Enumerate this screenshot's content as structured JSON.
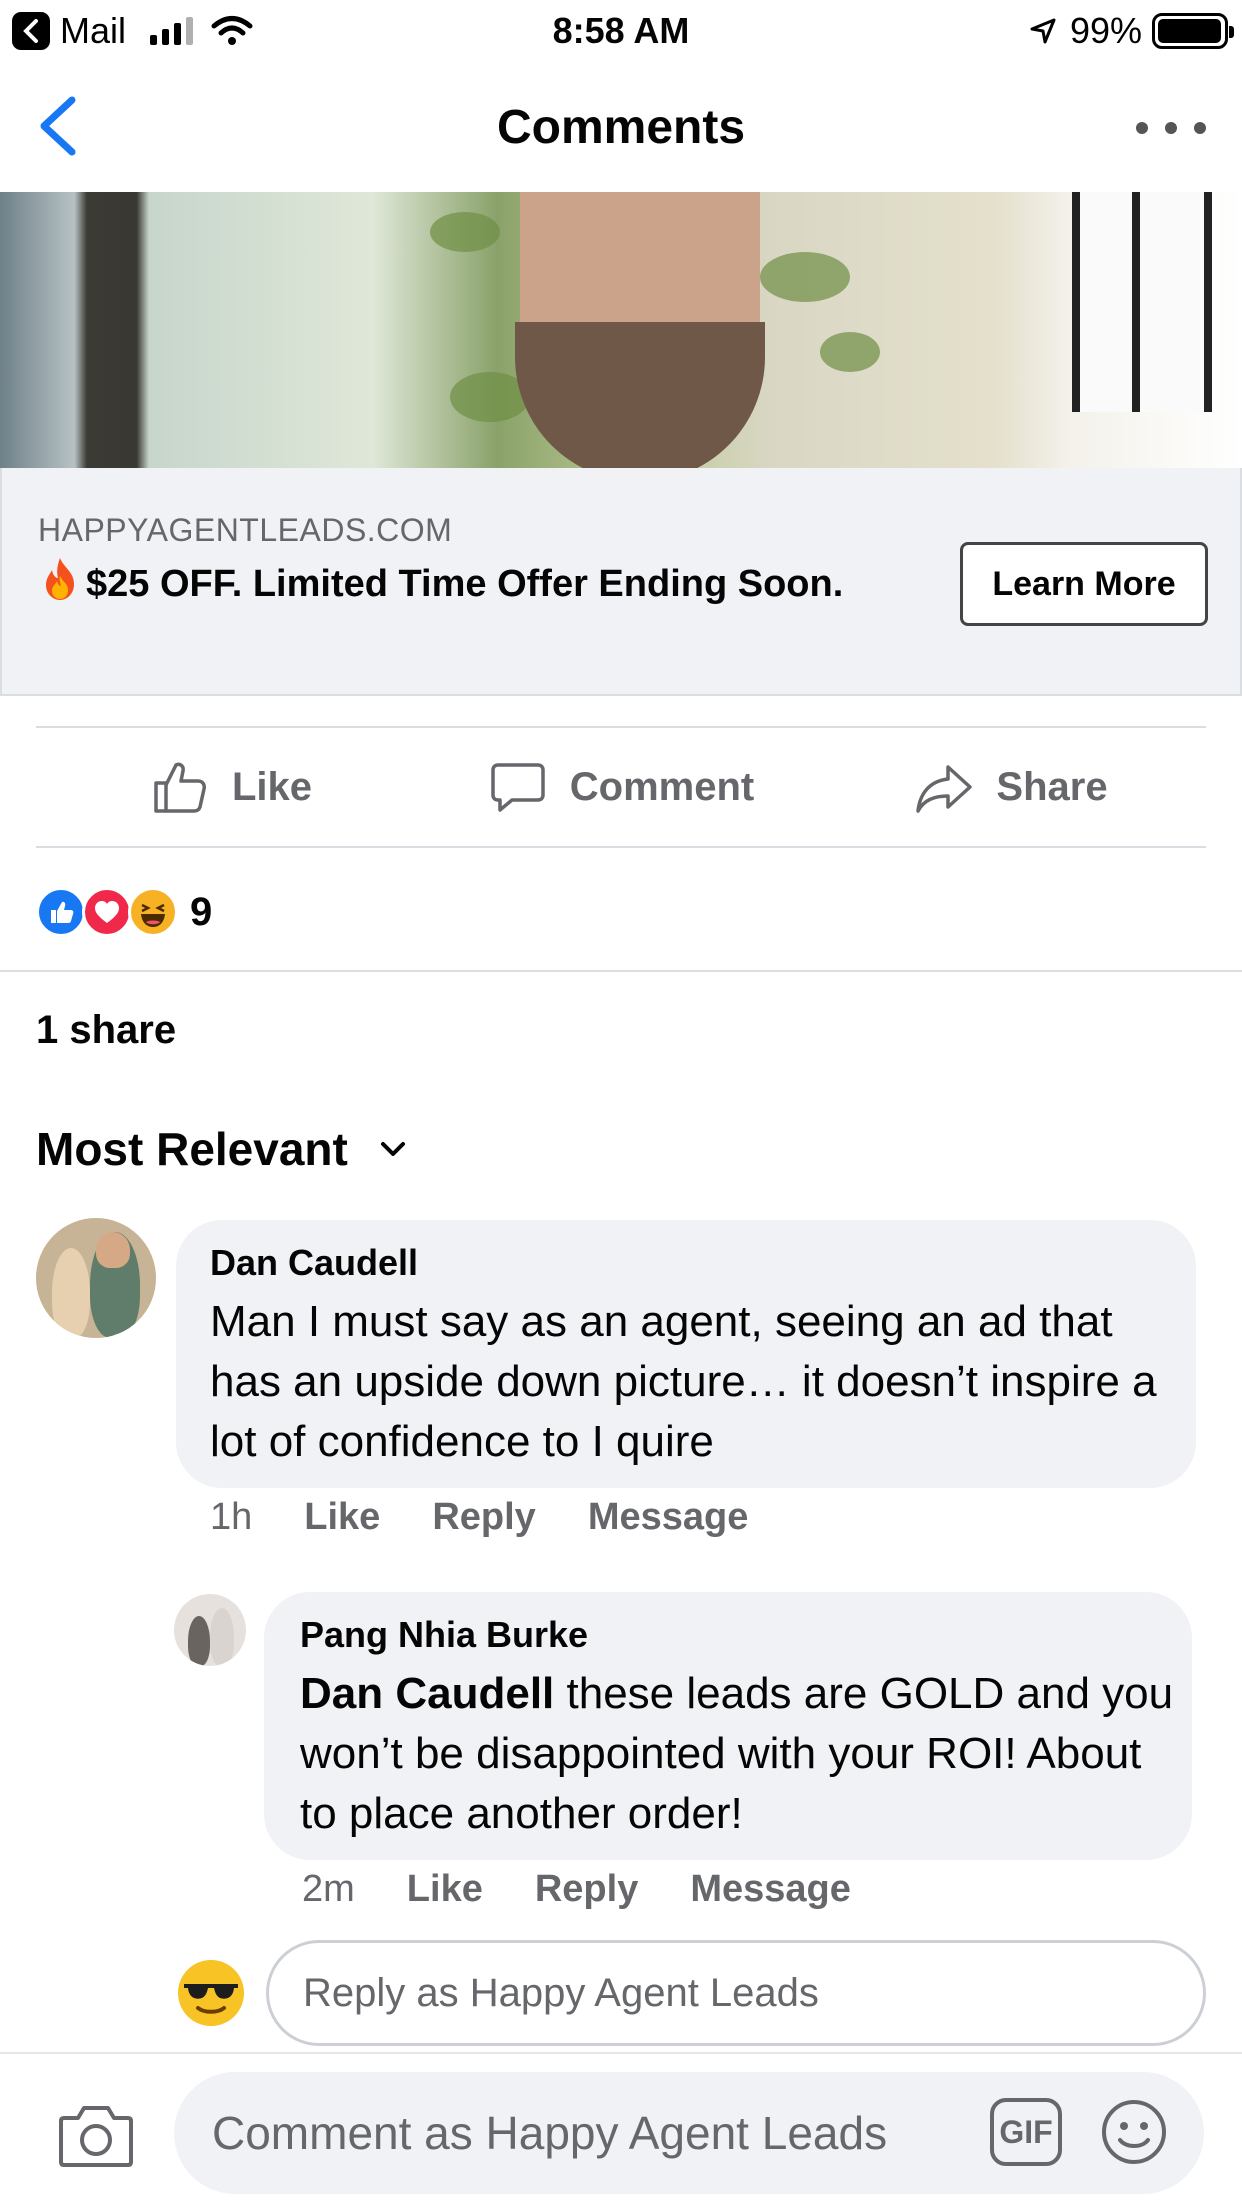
{
  "status_bar": {
    "back_app": "Mail",
    "time": "8:58 AM",
    "battery": "99%",
    "battery_level": 0.99
  },
  "nav": {
    "title": "Comments",
    "back_icon": "chevron-left-icon",
    "more_icon": "more-icon"
  },
  "ad": {
    "domain": "HAPPYAGENTLEADS.COM",
    "headline": "$25 OFF. Limited Time Offer Ending Soon.",
    "cta": "Learn More"
  },
  "actions": {
    "like": "Like",
    "comment": "Comment",
    "share": "Share"
  },
  "reactions": {
    "count": "9"
  },
  "shares": "1 share",
  "sort_label": "Most Relevant",
  "comments": [
    {
      "author": "Dan Caudell",
      "text": "Man I must say as an agent, seeing an ad that has an upside down picture… it doesn’t inspire a lot of confidence to I quire",
      "time": "1h",
      "like": "Like",
      "reply": "Reply",
      "message": "Message"
    },
    {
      "author": "Pang Nhia Burke",
      "mention": "Dan Caudell",
      "text": " these leads are GOLD and you won’t be disappointed with your ROI! About to place another order!",
      "time": "2m",
      "like": "Like",
      "reply": "Reply",
      "message": "Message"
    }
  ],
  "reply_placeholder": "Reply as Happy Agent Leads",
  "comment_placeholder": "Comment as Happy Agent Leads",
  "gif_label": "GIF",
  "colors": {
    "accent": "#1877f2",
    "secondary_text": "#65676b",
    "bubble": "#f0f2f5"
  }
}
